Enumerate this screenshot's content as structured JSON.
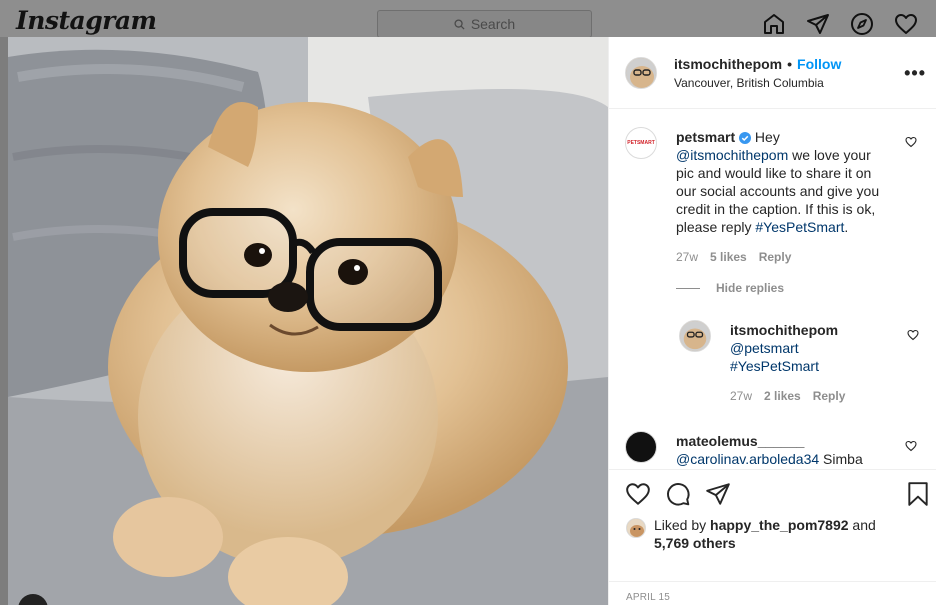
{
  "topbar": {
    "logo": "Instagram",
    "search_placeholder": "Search",
    "nav_icons": [
      "home-icon",
      "direct-icon",
      "explore-icon",
      "activity-icon"
    ]
  },
  "post": {
    "username": "itsmochithepom",
    "separator": "•",
    "follow_label": "Follow",
    "location": "Vancouver, British Columbia",
    "more_label": "•••"
  },
  "comments": [
    {
      "user": "petsmart",
      "avatar_text": "PETSMART",
      "pre": "Hey ",
      "mention": "@itsmochithepom",
      "mid": " we love your pic and would like to share it on our social accounts and give you credit in the caption. If this is ok, please reply ",
      "hashtag": "#YesPetSmart",
      "post": ".",
      "time": "27w",
      "likes": "5 likes",
      "reply": "Reply"
    },
    {
      "user": "itsmochithepom",
      "mention": "@petsmart",
      "hashtag": "#YesPetSmart",
      "time": "27w",
      "likes": "2 likes",
      "reply": "Reply"
    },
    {
      "user": "mateolemus______",
      "mention": "@carolinav.arboleda34",
      "text": " Simba"
    }
  ],
  "hide_replies_label": "Hide replies",
  "likes": {
    "prefix": "Liked by ",
    "user": "happy_the_pom7892",
    "mid": " and",
    "count": "5,769 others"
  },
  "date": "APRIL 15",
  "colors": {
    "accent": "#0095f6",
    "mention": "#00376b",
    "muted": "#8e8e8e"
  }
}
